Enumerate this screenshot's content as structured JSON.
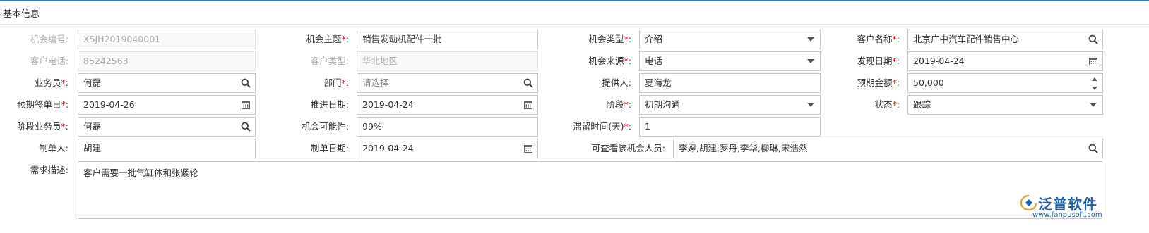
{
  "section": {
    "title": "基本信息"
  },
  "colors": {
    "accent": "#2f78c4",
    "required": "#e60012",
    "brand": "#1f5fa6"
  },
  "fields": {
    "opp_no": {
      "label": "机会编号:",
      "value": "XSJH2019040001"
    },
    "subject": {
      "label": "机会主题",
      "value": "销售发动机配件一批"
    },
    "opp_type": {
      "label": "机会类型",
      "value": "介绍"
    },
    "customer_name": {
      "label": "客户名称",
      "value": "北京广中汽车配件销售中心"
    },
    "customer_phone": {
      "label": "客户电话:",
      "value": "85242563"
    },
    "customer_type": {
      "label": "客户类型:",
      "value": "华北地区"
    },
    "opp_source": {
      "label": "机会来源",
      "value": "电话"
    },
    "found_date": {
      "label": "发现日期",
      "value": "2019-04-24"
    },
    "salesperson": {
      "label": "业务员",
      "value": "何磊"
    },
    "department": {
      "label": "部门",
      "placeholder": "请选择"
    },
    "provider": {
      "label": "提供人:",
      "value": "夏海龙"
    },
    "expected_amount": {
      "label": "预期金额",
      "value": "50,000"
    },
    "expected_sign_date": {
      "label": "预期签单日",
      "value": "2019-04-26"
    },
    "advance_date": {
      "label": "推进日期:",
      "value": "2019-04-24"
    },
    "stage": {
      "label": "阶段",
      "value": "初期沟通"
    },
    "status": {
      "label": "状态",
      "value": "跟踪"
    },
    "stage_salesperson": {
      "label": "阶段业务员",
      "value": "何磊"
    },
    "probability": {
      "label": "机会可能性:",
      "value": "99%"
    },
    "stay_days": {
      "label": "滞留时间(天)",
      "value": "1"
    },
    "creator": {
      "label": "制单人:",
      "value": "胡建"
    },
    "create_date": {
      "label": "制单日期:",
      "value": "2019-04-24"
    },
    "viewers": {
      "label": "可查看该机会人员:",
      "value": "李婷,胡建,罗丹,李华,柳琳,宋浩然"
    },
    "requirement": {
      "label": "需求描述:",
      "value": "客户需要一批气缸体和张紧轮"
    }
  },
  "required_marker": "*",
  "required_suffix": ":",
  "logo": {
    "brand": "泛普软件",
    "url": "www.fanpusoft.com"
  }
}
